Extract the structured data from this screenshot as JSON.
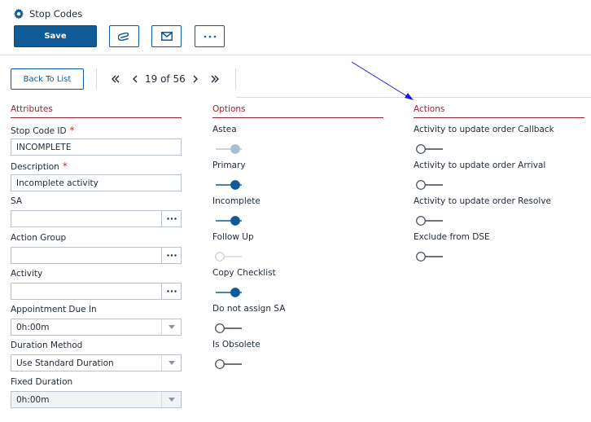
{
  "header": {
    "title": "Stop Codes",
    "save_label": "Save",
    "attach_icon": "paperclip-icon",
    "email_icon": "envelope-icon",
    "more_icon": "ellipsis-icon",
    "accent_color": "#0f5a97"
  },
  "toolbar": {
    "back_label": "Back To List",
    "pager_text": "19 of 56"
  },
  "attributes": {
    "heading": "Attributes",
    "stop_code_id": {
      "label": "Stop Code ID",
      "required_mark": "*",
      "value": "INCOMPLETE"
    },
    "description": {
      "label": "Description",
      "required_mark": "*",
      "value": "Incomplete activity"
    },
    "sa": {
      "label": "SA",
      "value": ""
    },
    "action_group": {
      "label": "Action Group",
      "value": ""
    },
    "activity": {
      "label": "Activity",
      "value": ""
    },
    "appointment_due_in": {
      "label": "Appointment Due In",
      "value": "0h:00m"
    },
    "duration_method": {
      "label": "Duration Method",
      "value": "Use Standard Duration"
    },
    "fixed_duration": {
      "label": "Fixed Duration",
      "value": "0h:00m"
    }
  },
  "options": {
    "heading": "Options",
    "items": [
      {
        "label": "Astea",
        "state": "on-disabled"
      },
      {
        "label": "Primary",
        "state": "on"
      },
      {
        "label": "Incomplete",
        "state": "on"
      },
      {
        "label": "Follow Up",
        "state": "off-disabled"
      },
      {
        "label": "Copy Checklist",
        "state": "on"
      },
      {
        "label": "Do not assign SA",
        "state": "off"
      },
      {
        "label": "Is Obsolete",
        "state": "off"
      }
    ]
  },
  "actions": {
    "heading": "Actions",
    "items": [
      {
        "label": "Activity to update order Callback",
        "state": "off"
      },
      {
        "label": "Activity to update order Arrival",
        "state": "off"
      },
      {
        "label": "Activity to update order Resolve",
        "state": "off"
      },
      {
        "label": "Exclude from DSE",
        "state": "off"
      }
    ]
  }
}
